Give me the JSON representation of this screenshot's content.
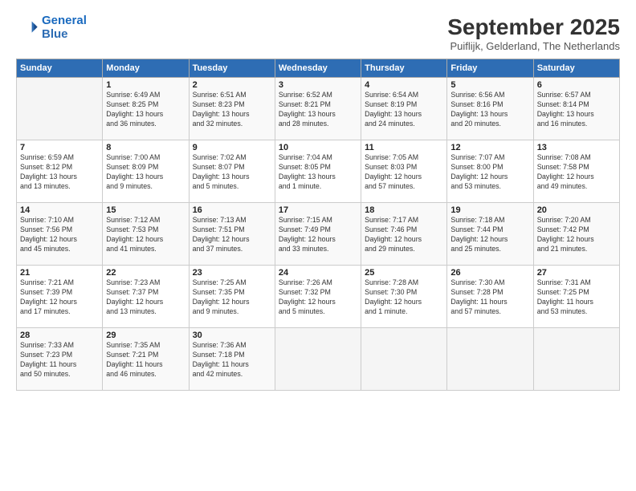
{
  "logo": {
    "line1": "General",
    "line2": "Blue"
  },
  "title": "September 2025",
  "subtitle": "Puiflijk, Gelderland, The Netherlands",
  "weekdays": [
    "Sunday",
    "Monday",
    "Tuesday",
    "Wednesday",
    "Thursday",
    "Friday",
    "Saturday"
  ],
  "weeks": [
    [
      {
        "day": "",
        "info": ""
      },
      {
        "day": "1",
        "info": "Sunrise: 6:49 AM\nSunset: 8:25 PM\nDaylight: 13 hours\nand 36 minutes."
      },
      {
        "day": "2",
        "info": "Sunrise: 6:51 AM\nSunset: 8:23 PM\nDaylight: 13 hours\nand 32 minutes."
      },
      {
        "day": "3",
        "info": "Sunrise: 6:52 AM\nSunset: 8:21 PM\nDaylight: 13 hours\nand 28 minutes."
      },
      {
        "day": "4",
        "info": "Sunrise: 6:54 AM\nSunset: 8:19 PM\nDaylight: 13 hours\nand 24 minutes."
      },
      {
        "day": "5",
        "info": "Sunrise: 6:56 AM\nSunset: 8:16 PM\nDaylight: 13 hours\nand 20 minutes."
      },
      {
        "day": "6",
        "info": "Sunrise: 6:57 AM\nSunset: 8:14 PM\nDaylight: 13 hours\nand 16 minutes."
      }
    ],
    [
      {
        "day": "7",
        "info": "Sunrise: 6:59 AM\nSunset: 8:12 PM\nDaylight: 13 hours\nand 13 minutes."
      },
      {
        "day": "8",
        "info": "Sunrise: 7:00 AM\nSunset: 8:09 PM\nDaylight: 13 hours\nand 9 minutes."
      },
      {
        "day": "9",
        "info": "Sunrise: 7:02 AM\nSunset: 8:07 PM\nDaylight: 13 hours\nand 5 minutes."
      },
      {
        "day": "10",
        "info": "Sunrise: 7:04 AM\nSunset: 8:05 PM\nDaylight: 13 hours\nand 1 minute."
      },
      {
        "day": "11",
        "info": "Sunrise: 7:05 AM\nSunset: 8:03 PM\nDaylight: 12 hours\nand 57 minutes."
      },
      {
        "day": "12",
        "info": "Sunrise: 7:07 AM\nSunset: 8:00 PM\nDaylight: 12 hours\nand 53 minutes."
      },
      {
        "day": "13",
        "info": "Sunrise: 7:08 AM\nSunset: 7:58 PM\nDaylight: 12 hours\nand 49 minutes."
      }
    ],
    [
      {
        "day": "14",
        "info": "Sunrise: 7:10 AM\nSunset: 7:56 PM\nDaylight: 12 hours\nand 45 minutes."
      },
      {
        "day": "15",
        "info": "Sunrise: 7:12 AM\nSunset: 7:53 PM\nDaylight: 12 hours\nand 41 minutes."
      },
      {
        "day": "16",
        "info": "Sunrise: 7:13 AM\nSunset: 7:51 PM\nDaylight: 12 hours\nand 37 minutes."
      },
      {
        "day": "17",
        "info": "Sunrise: 7:15 AM\nSunset: 7:49 PM\nDaylight: 12 hours\nand 33 minutes."
      },
      {
        "day": "18",
        "info": "Sunrise: 7:17 AM\nSunset: 7:46 PM\nDaylight: 12 hours\nand 29 minutes."
      },
      {
        "day": "19",
        "info": "Sunrise: 7:18 AM\nSunset: 7:44 PM\nDaylight: 12 hours\nand 25 minutes."
      },
      {
        "day": "20",
        "info": "Sunrise: 7:20 AM\nSunset: 7:42 PM\nDaylight: 12 hours\nand 21 minutes."
      }
    ],
    [
      {
        "day": "21",
        "info": "Sunrise: 7:21 AM\nSunset: 7:39 PM\nDaylight: 12 hours\nand 17 minutes."
      },
      {
        "day": "22",
        "info": "Sunrise: 7:23 AM\nSunset: 7:37 PM\nDaylight: 12 hours\nand 13 minutes."
      },
      {
        "day": "23",
        "info": "Sunrise: 7:25 AM\nSunset: 7:35 PM\nDaylight: 12 hours\nand 9 minutes."
      },
      {
        "day": "24",
        "info": "Sunrise: 7:26 AM\nSunset: 7:32 PM\nDaylight: 12 hours\nand 5 minutes."
      },
      {
        "day": "25",
        "info": "Sunrise: 7:28 AM\nSunset: 7:30 PM\nDaylight: 12 hours\nand 1 minute."
      },
      {
        "day": "26",
        "info": "Sunrise: 7:30 AM\nSunset: 7:28 PM\nDaylight: 11 hours\nand 57 minutes."
      },
      {
        "day": "27",
        "info": "Sunrise: 7:31 AM\nSunset: 7:25 PM\nDaylight: 11 hours\nand 53 minutes."
      }
    ],
    [
      {
        "day": "28",
        "info": "Sunrise: 7:33 AM\nSunset: 7:23 PM\nDaylight: 11 hours\nand 50 minutes."
      },
      {
        "day": "29",
        "info": "Sunrise: 7:35 AM\nSunset: 7:21 PM\nDaylight: 11 hours\nand 46 minutes."
      },
      {
        "day": "30",
        "info": "Sunrise: 7:36 AM\nSunset: 7:18 PM\nDaylight: 11 hours\nand 42 minutes."
      },
      {
        "day": "",
        "info": ""
      },
      {
        "day": "",
        "info": ""
      },
      {
        "day": "",
        "info": ""
      },
      {
        "day": "",
        "info": ""
      }
    ]
  ]
}
